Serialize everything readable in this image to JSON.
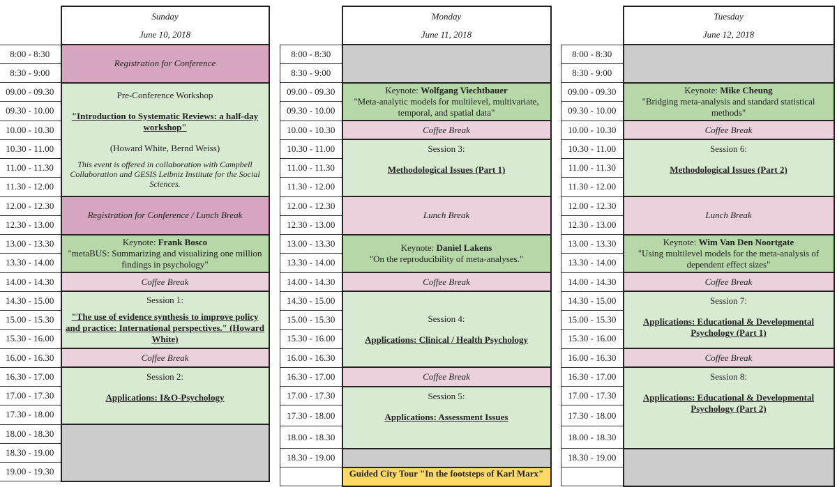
{
  "times": [
    "8:00 - 8:30",
    "8:30 - 9:00",
    "09.00 - 09.30",
    "09.30 - 10.00",
    "10.00 - 10.30",
    "10.30 - 11.00",
    "11.00 - 11.30",
    "11.30 - 12.00",
    "12.00 - 12.30",
    "12.30 - 13.00",
    "13.00 - 13.30",
    "13.30 - 14.00",
    "14.00 - 14.30",
    "14.30 - 15.00",
    "15.00 - 15.30",
    "15.30 - 16.00",
    "16.00 - 16.30",
    "16.30 - 17.00",
    "17.00 - 17.30",
    "17.30 - 18.00",
    "18.00 - 18.30",
    "18.30 - 19.00",
    "19.00 - 19.30",
    ""
  ],
  "colors": {
    "registration": "#d5a6bd",
    "coffee_lunch": "#ead1dc",
    "session": "#d9ead3",
    "keynote": "#b6d7a8",
    "free": "#cccccc",
    "tour": "#ffd966"
  },
  "days": [
    {
      "name": "Sunday",
      "date": "June 10, 2018",
      "time_count": 23,
      "events": [
        {
          "span": 2,
          "color": "mauve",
          "lines": [
            {
              "s": "italic",
              "t": "Registration for Conference"
            }
          ]
        },
        {
          "span": 6,
          "color": "green",
          "lines": [
            {
              "s": "plain",
              "t": "Pre-Conference Workshop"
            },
            {
              "s": "title",
              "t": "\"Introduction to Systematic Reviews: a half-day workshop\"",
              "gap": true
            },
            {
              "s": "plain",
              "t": "(Howard White, Bernd Weiss)",
              "gap": true
            },
            {
              "s": "note",
              "t": "This event is offered in collaboration with Campbell Collaboration and GESIS Leibniz Institute for the Social Sciences.",
              "gaps": true
            }
          ]
        },
        {
          "span": 2,
          "color": "mauve",
          "lines": [
            {
              "s": "italic",
              "t": "Registration for Conference / Lunch Break"
            }
          ]
        },
        {
          "span": 2,
          "color": "key",
          "lines": [
            {
              "s": "keynote",
              "t": "Keynote: ",
              "b": "Frank Bosco"
            },
            {
              "s": "plain",
              "t": "\"metaBUS: Summarizing and visualizing one million findings in psychology\""
            }
          ]
        },
        {
          "span": 1,
          "color": "pink",
          "lines": [
            {
              "s": "italic",
              "t": "Coffee Break"
            }
          ]
        },
        {
          "span": 3,
          "color": "green",
          "lines": [
            {
              "s": "plain",
              "t": "Session 1:"
            },
            {
              "s": "title",
              "t": "\"The use of evidence synthesis to improve policy and practice: International perspectives.\" (Howard White)",
              "gaps": true
            }
          ]
        },
        {
          "span": 1,
          "color": "pink",
          "lines": [
            {
              "s": "italic",
              "t": "Coffee Break"
            }
          ]
        },
        {
          "span": 3,
          "color": "green",
          "lines": [
            {
              "s": "plain",
              "t": "Session 2:"
            },
            {
              "s": "title",
              "t": "Applications: I&O-Psychology",
              "gap": true
            }
          ],
          "top": true
        },
        {
          "span": 3,
          "color": "gray",
          "lines": []
        }
      ]
    },
    {
      "name": "Monday",
      "date": "June 11, 2018",
      "time_count": 22,
      "events": [
        {
          "span": 2,
          "color": "gray",
          "lines": []
        },
        {
          "span": 2,
          "color": "key",
          "lines": [
            {
              "s": "keynote",
              "t": "Keynote: ",
              "b": "Wolfgang Viechtbauer"
            },
            {
              "s": "plain",
              "t": "\"Meta-analytic models for multilevel, multivariate, temporal, and spatial data\""
            }
          ]
        },
        {
          "span": 1,
          "color": "pink",
          "lines": [
            {
              "s": "italic",
              "t": "Coffee Break"
            }
          ]
        },
        {
          "span": 3,
          "color": "green",
          "lines": [
            {
              "s": "plain",
              "t": "Session 3:"
            },
            {
              "s": "title",
              "t": "Methodological Issues (Part 1)",
              "gap": true
            }
          ],
          "top": true
        },
        {
          "span": 2,
          "color": "pink",
          "lines": [
            {
              "s": "italic",
              "t": "Lunch  Break"
            }
          ]
        },
        {
          "span": 2,
          "color": "key",
          "lines": [
            {
              "s": "keynote",
              "t": "Keynote: ",
              "b": "Daniel Lakens"
            },
            {
              "s": "plain",
              "t": "\"On the reproducibility of meta-analyses.\""
            }
          ]
        },
        {
          "span": 1,
          "color": "pink",
          "lines": [
            {
              "s": "italic",
              "t": "Coffee Break"
            }
          ]
        },
        {
          "span": 4,
          "color": "green",
          "lines": [
            {
              "s": "plain",
              "t": "Session 4:"
            },
            {
              "s": "title",
              "t": "Applications: Clinical / Health Psychology",
              "gap": true
            }
          ]
        },
        {
          "span": 1,
          "color": "pink",
          "lines": [
            {
              "s": "italic",
              "t": "Coffee Break"
            }
          ]
        },
        {
          "span": 3,
          "color": "green",
          "lines": [
            {
              "s": "plain",
              "t": "Session 5:"
            },
            {
              "s": "title",
              "t": "Applications: Assessment Issues",
              "gap": true
            }
          ],
          "top": true
        },
        {
          "span": 1,
          "color": "gray",
          "lines": []
        },
        {
          "span": 1,
          "color": "orange",
          "lines": [
            {
              "s": "bold",
              "t": "Guided City Tour \"In the footsteps of Karl Marx\""
            }
          ]
        }
      ]
    },
    {
      "name": "Tuesday",
      "date": "June 12, 2018",
      "time_count": 22,
      "events": [
        {
          "span": 2,
          "color": "gray",
          "lines": []
        },
        {
          "span": 2,
          "color": "key",
          "lines": [
            {
              "s": "keynote",
              "t": "Keynote: ",
              "b": "Mike Cheung"
            },
            {
              "s": "plain",
              "t": "\"Bridging meta-analysis and standard statistical methods\""
            }
          ]
        },
        {
          "span": 1,
          "color": "pink",
          "lines": [
            {
              "s": "italic",
              "t": "Coffee Break"
            }
          ]
        },
        {
          "span": 3,
          "color": "green",
          "lines": [
            {
              "s": "plain",
              "t": "Session 6:"
            },
            {
              "s": "title",
              "t": "Methodological Issues (Part 2)",
              "gap": true
            }
          ],
          "top": true
        },
        {
          "span": 2,
          "color": "pink",
          "lines": [
            {
              "s": "italic",
              "t": "Lunch  Break"
            }
          ]
        },
        {
          "span": 2,
          "color": "key",
          "lines": [
            {
              "s": "keynote",
              "t": "Keynote: ",
              "b": "Wim Van Den Noortgate"
            },
            {
              "s": "plain",
              "t": "\"Using multilevel models for the meta-analysis of dependent effect sizes\""
            }
          ]
        },
        {
          "span": 1,
          "color": "pink",
          "lines": [
            {
              "s": "italic",
              "t": "Coffee Break"
            }
          ]
        },
        {
          "span": 3,
          "color": "green",
          "lines": [
            {
              "s": "plain",
              "t": "Session 7:"
            },
            {
              "s": "title",
              "t": "Applications: Educational & Developmental Psychology (Part 1)",
              "gap": true
            }
          ],
          "top": true
        },
        {
          "span": 1,
          "color": "pink",
          "lines": [
            {
              "s": "italic",
              "t": "Coffee Break"
            }
          ]
        },
        {
          "span": 4,
          "color": "green",
          "lines": [
            {
              "s": "plain",
              "t": "Session 8:"
            },
            {
              "s": "title",
              "t": "Applications: Educational & Developmental Psychology (Part 2)",
              "gap": true
            }
          ],
          "top": true
        },
        {
          "span": 2,
          "color": "gray",
          "lines": []
        }
      ]
    }
  ]
}
